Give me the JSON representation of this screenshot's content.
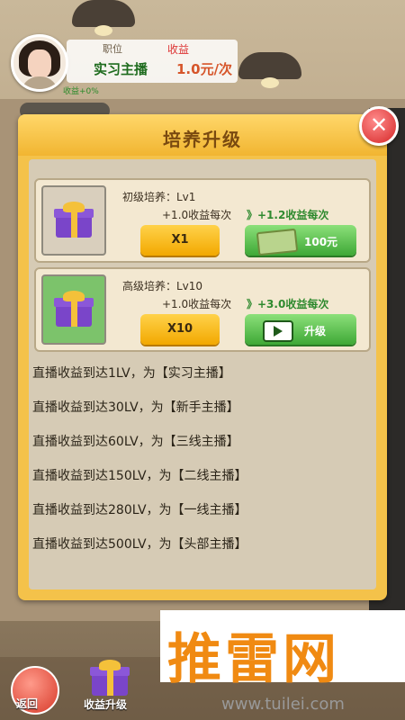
{
  "header": {
    "position_label": "职位",
    "income_label": "收益",
    "position_value": "实习主播",
    "income_value": "1.0元/次",
    "small_stat": "收益+0%"
  },
  "modal": {
    "title": "培养升级",
    "close_icon": "close-icon",
    "cards": [
      {
        "title": "初级培养：Lv1",
        "from": "+1.0收益每次",
        "arrow": "》",
        "to": "+1.2收益每次",
        "multiplier": "X1",
        "action_label": "100元",
        "action_icon": "money-icon"
      },
      {
        "title": "高级培养：Lv10",
        "from": "+1.0收益每次",
        "arrow": "》",
        "to": "+3.0收益每次",
        "multiplier": "X10",
        "action_label": "升级",
        "action_icon": "video-icon"
      }
    ],
    "levels": [
      "直播收益到达1LV，为【实习主播】",
      "直播收益到达30LV，为【新手主播】",
      "直播收益到达60LV，为【三线主播】",
      "直播收益到达150LV，为【二线主播】",
      "直播收益到达280LV，为【一线主播】",
      "直播收益到达500LV，为【头部主播】"
    ]
  },
  "bottom": {
    "back_label": "返回",
    "upgrade_label": "收益升级"
  },
  "watermark": {
    "text": "推雷网",
    "url": "www.tuilei.com"
  },
  "colors": {
    "modal_gold": "#f4c24a",
    "title_brown": "#7a4a10",
    "green_button": "#3ea836",
    "yellow_button": "#f2a800",
    "close_red": "#d52626"
  }
}
